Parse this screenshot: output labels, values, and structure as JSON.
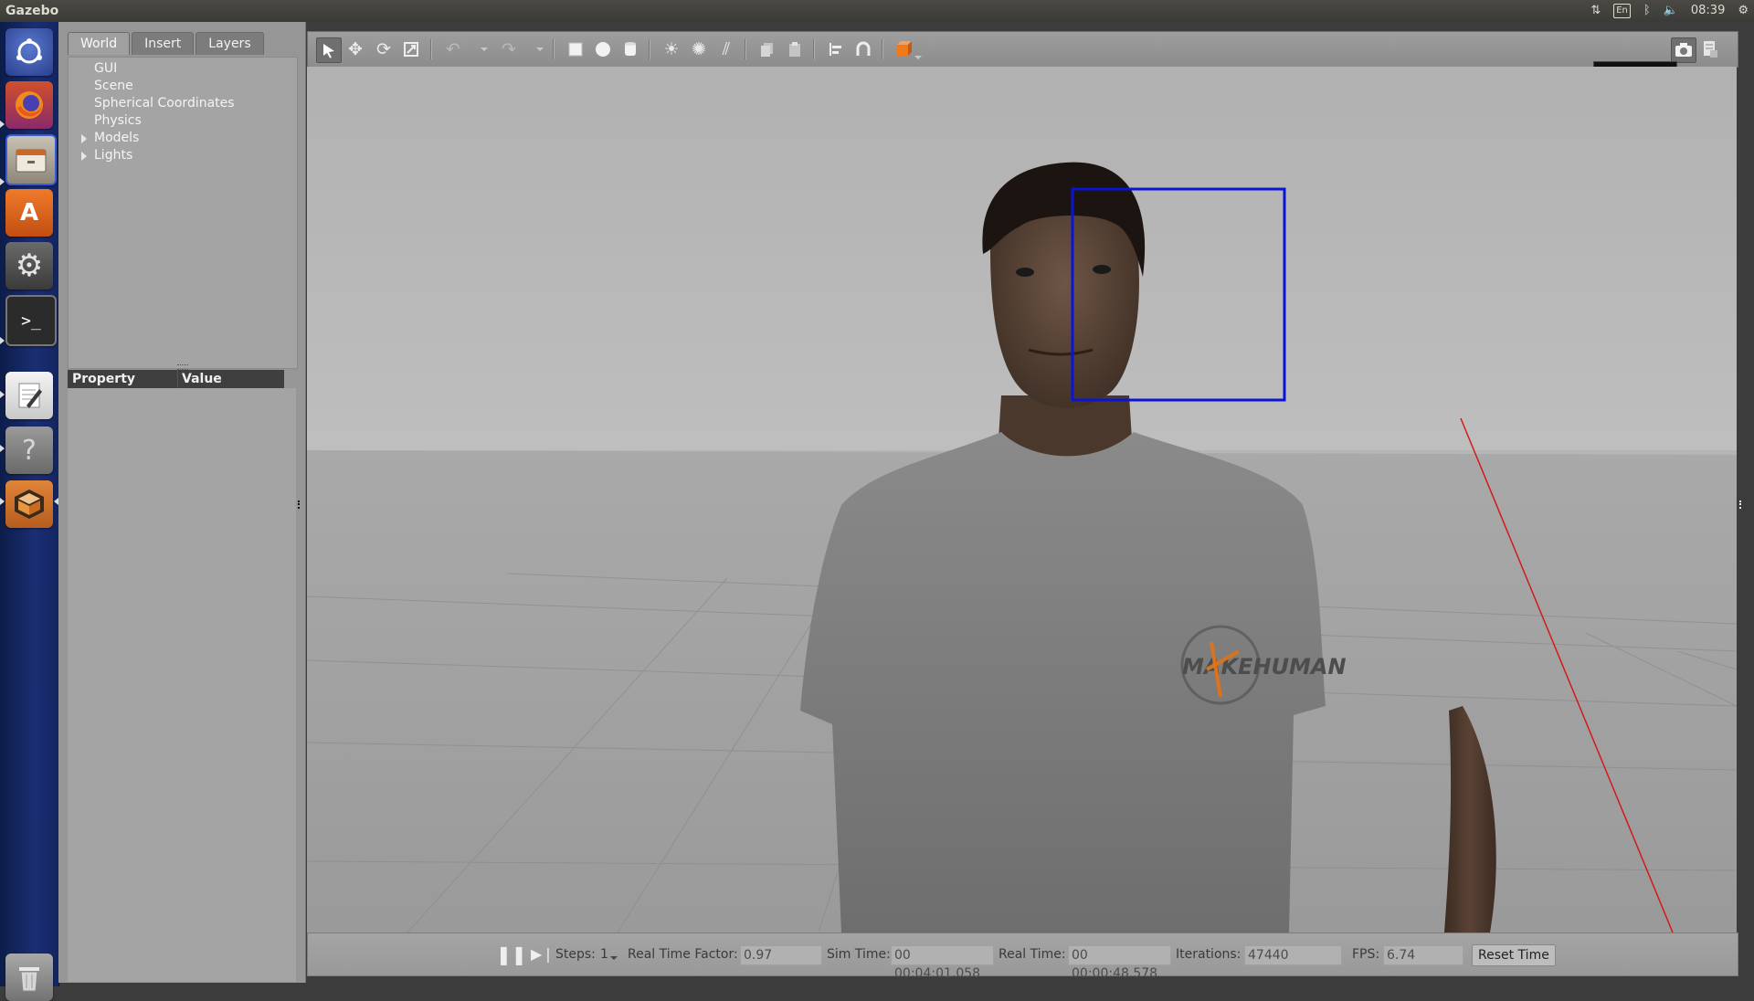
{
  "topbar": {
    "app_title": "Gazebo",
    "keyboard_layout": "En",
    "clock": "08:39",
    "icons": [
      "network-arrows-icon",
      "keyboard-layout-icon",
      "bluetooth-icon",
      "volume-icon",
      "settings-gear-icon"
    ]
  },
  "launcher": {
    "items": [
      {
        "name": "ubuntu-dash-icon"
      },
      {
        "name": "firefox-icon"
      },
      {
        "name": "files-icon"
      },
      {
        "name": "software-center-icon"
      },
      {
        "name": "system-settings-icon"
      },
      {
        "name": "terminal-icon"
      },
      {
        "name": "text-editor-icon"
      },
      {
        "name": "help-icon"
      },
      {
        "name": "gazebo-icon"
      },
      {
        "name": "trash-icon"
      }
    ]
  },
  "left_panel": {
    "tabs": [
      "World",
      "Insert",
      "Layers"
    ],
    "active_tab": "World",
    "tree": [
      "GUI",
      "Scene",
      "Spherical Coordinates",
      "Physics",
      "Models",
      "Lights"
    ],
    "property_header": {
      "property": "Property",
      "value": "Value"
    }
  },
  "toolbar": {
    "tools": [
      "select-arrow-icon",
      "translate-icon",
      "rotate-icon",
      "scale-icon",
      "undo-icon",
      "redo-icon",
      "box-icon",
      "sphere-icon",
      "cylinder-icon",
      "point-light-icon",
      "spot-light-icon",
      "directional-light-icon",
      "copy-icon",
      "paste-icon",
      "align-icon",
      "snap-icon",
      "view-angle-icon",
      "screenshot-icon",
      "log-icon"
    ],
    "tooltip": "Screenshot"
  },
  "viewport": {
    "shirt_logo": "MAKEHUMAN",
    "face_box_color": "#0a14d6",
    "axis_color": "#d11b1b"
  },
  "bottom_bar": {
    "steps_label": "Steps:",
    "steps_value": "1",
    "rtf_label": "Real Time Factor:",
    "rtf_value": "0.97",
    "sim_time_label": "Sim Time:",
    "sim_time_value": "00 00:04:01.058",
    "real_time_label": "Real Time:",
    "real_time_value": "00 00:00:48.578",
    "iterations_label": "Iterations:",
    "iterations_value": "47440",
    "fps_label": "FPS:",
    "fps_value": "6.74",
    "reset_label": "Reset Time"
  }
}
